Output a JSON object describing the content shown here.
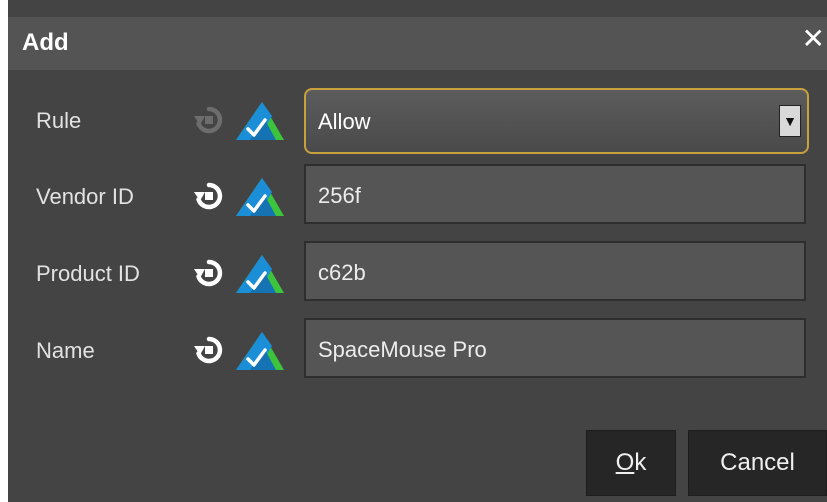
{
  "dialog": {
    "title": "Add",
    "close_glyph": "✕"
  },
  "fields": {
    "rule": {
      "label": "Rule",
      "value": "Allow"
    },
    "vendor_id": {
      "label": "Vendor ID",
      "value": "256f"
    },
    "product_id": {
      "label": "Product ID",
      "value": "c62b"
    },
    "name": {
      "label": "Name",
      "value": "SpaceMouse Pro"
    }
  },
  "buttons": {
    "ok_mnemonic": "O",
    "ok_rest": "k",
    "cancel": "Cancel"
  },
  "icons": {
    "reset": "reset-icon",
    "inherit": "inherit-icon",
    "dropdown": "chevron-down-icon"
  },
  "colors": {
    "dialog_bg": "#444444",
    "titlebar_bg": "#545454",
    "field_bg": "#555555",
    "focus_border": "#c7a13b",
    "button_bg": "#262626",
    "icon_blue": "#1a8fd8",
    "icon_green": "#3cc43c"
  }
}
